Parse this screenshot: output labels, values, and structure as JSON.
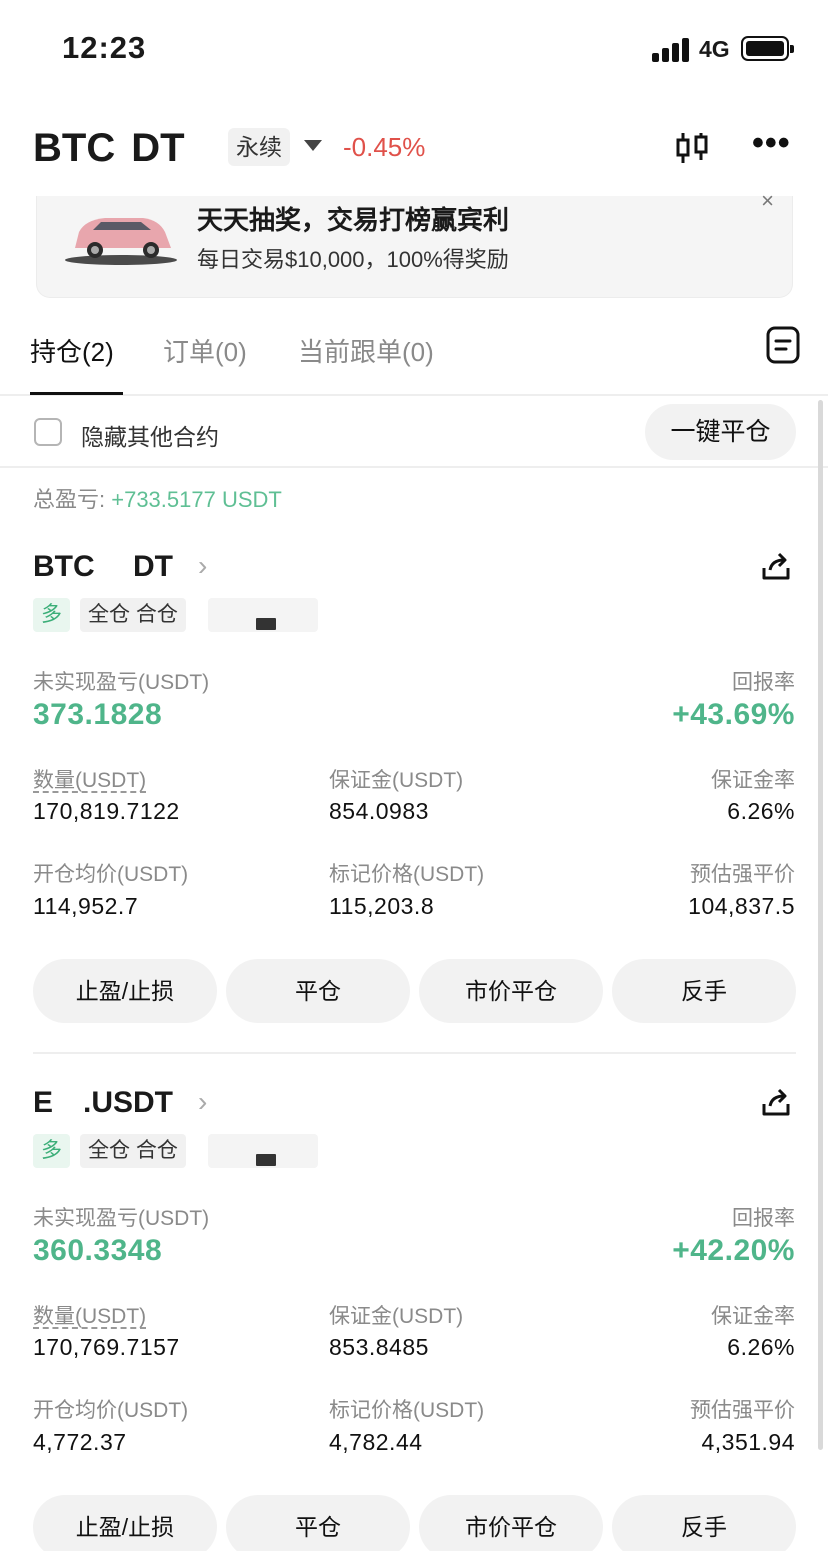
{
  "status_bar": {
    "time": "12:23",
    "network": "4G"
  },
  "header": {
    "symbol": "BTC  DT",
    "contract_type": "永续",
    "change": "-0.45%"
  },
  "banner": {
    "title": "天天抽奖，交易打榜赢宾利",
    "subtitle": "每日交易$10,000，100%得奖励",
    "close": "×"
  },
  "tabs": [
    {
      "label": "持仓(2)",
      "active": true
    },
    {
      "label": "订单(0)",
      "active": false
    },
    {
      "label": "当前跟单(0)",
      "active": false
    }
  ],
  "filter": {
    "hide_label": "隐藏其他合约",
    "close_all": "一键平仓"
  },
  "total_pnl": {
    "label": "总盈亏: ",
    "value": "+733.5177 USDT"
  },
  "positions": [
    {
      "symbol": "BTC  DT",
      "tags": {
        "side": "多",
        "mode": "全仓 合仓"
      },
      "unrealized_label": "未实现盈亏(USDT)",
      "unrealized": "373.1828",
      "roe_label": "回报率",
      "roe": "+43.69%",
      "qty_label": "数量(USDT)",
      "qty": "170,819.7122",
      "margin_label": "保证金(USDT)",
      "margin": "854.0983",
      "margin_ratio_label": "保证金率",
      "margin_ratio": "6.26%",
      "entry_label": "开仓均价(USDT)",
      "entry": "114,952.7",
      "mark_label": "标记价格(USDT)",
      "mark": "115,203.8",
      "liq_label": "预估强平价",
      "liq": "104,837.5",
      "buttons": [
        "止盈/止损",
        "平仓",
        "市价平仓",
        "反手"
      ]
    },
    {
      "symbol": "E .USDT",
      "tags": {
        "side": "多",
        "mode": "全仓 合仓"
      },
      "unrealized_label": "未实现盈亏(USDT)",
      "unrealized": "360.3348",
      "roe_label": "回报率",
      "roe": "+42.20%",
      "qty_label": "数量(USDT)",
      "qty": "170,769.7157",
      "margin_label": "保证金(USDT)",
      "margin": "853.8485",
      "margin_ratio_label": "保证金率",
      "margin_ratio": "6.26%",
      "entry_label": "开仓均价(USDT)",
      "entry": "4,772.37",
      "mark_label": "标记价格(USDT)",
      "mark": "4,782.44",
      "liq_label": "预估强平价",
      "liq": "4,351.94",
      "buttons": [
        "止盈/止损",
        "平仓",
        "市价平仓",
        "反手"
      ]
    }
  ],
  "colors": {
    "profit": "#4fb58a",
    "loss": "#e0514a"
  },
  "icons": [
    "signal-icon",
    "battery-icon",
    "caret-down-icon",
    "candlestick-icon",
    "more-icon",
    "close-icon",
    "document-icon",
    "checkbox-icon",
    "chevron-right-icon",
    "share-icon"
  ]
}
